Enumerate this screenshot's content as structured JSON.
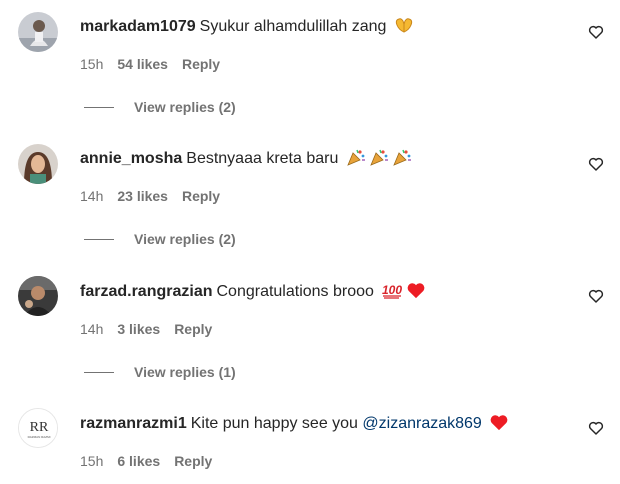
{
  "comments": [
    {
      "username": "markadam1079",
      "text": "Syukur alhamdulillah zang",
      "time": "15h",
      "likes": "54 likes",
      "reply": "Reply",
      "view_replies": "View replies (2)",
      "emojis": [
        "hands-icon"
      ]
    },
    {
      "username": "annie_mosha",
      "text": "Bestnyaaa kreta baru",
      "time": "14h",
      "likes": "23 likes",
      "reply": "Reply",
      "view_replies": "View replies (2)",
      "emojis": [
        "party-popper-icon",
        "party-popper-icon",
        "party-popper-icon"
      ]
    },
    {
      "username": "farzad.rangrazian",
      "text": "Congratulations brooo",
      "time": "14h",
      "likes": "3 likes",
      "reply": "Reply",
      "view_replies": "View replies (1)",
      "emojis": [
        "hundred-points-icon",
        "red-heart-icon"
      ]
    },
    {
      "username": "razmanrazmi1",
      "text_before": "Kite pun happy see you",
      "mention": "@zizanrazak869",
      "time": "15h",
      "likes": "6 likes",
      "reply": "Reply",
      "emojis": [
        "red-heart-icon"
      ],
      "avatar_logo_text": "RAZMAN RAZMI"
    }
  ],
  "colors": {
    "text": "#262626",
    "muted": "#737373",
    "mention": "#00376b",
    "heart": "#ed1c24"
  }
}
